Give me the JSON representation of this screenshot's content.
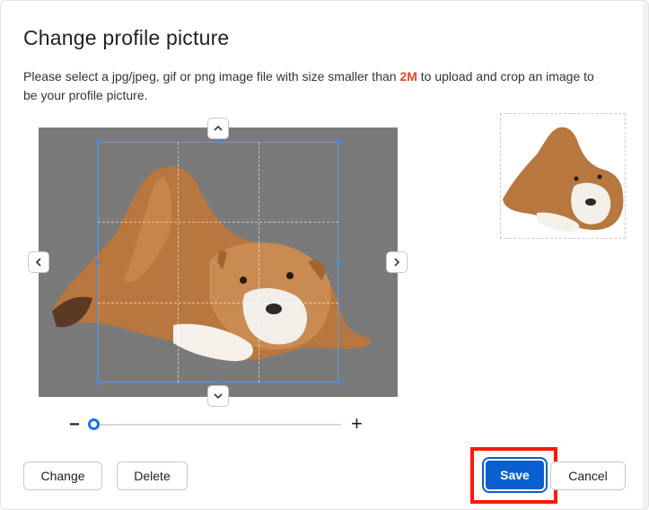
{
  "dialog": {
    "title": "Change profile picture",
    "description_before": "Please select a jpg/jpeg, gif or png image file with size smaller than ",
    "description_accent": "2M",
    "description_after": " to upload and crop an image to be your profile picture."
  },
  "cropper": {
    "nudge_up": "up-chevron-icon",
    "nudge_down": "down-chevron-icon",
    "nudge_left": "left-chevron-icon",
    "nudge_right": "right-chevron-icon"
  },
  "zoom": {
    "minus_label": "−",
    "plus_label": "+",
    "level": 0.0
  },
  "actions": {
    "change_label": "Change",
    "delete_label": "Delete",
    "save_label": "Save",
    "cancel_label": "Cancel"
  },
  "colors": {
    "accent": "#e8462a",
    "primary": "#0a5ecf",
    "crop_outline": "#3f8bea",
    "highlight": "#ff1a00"
  }
}
